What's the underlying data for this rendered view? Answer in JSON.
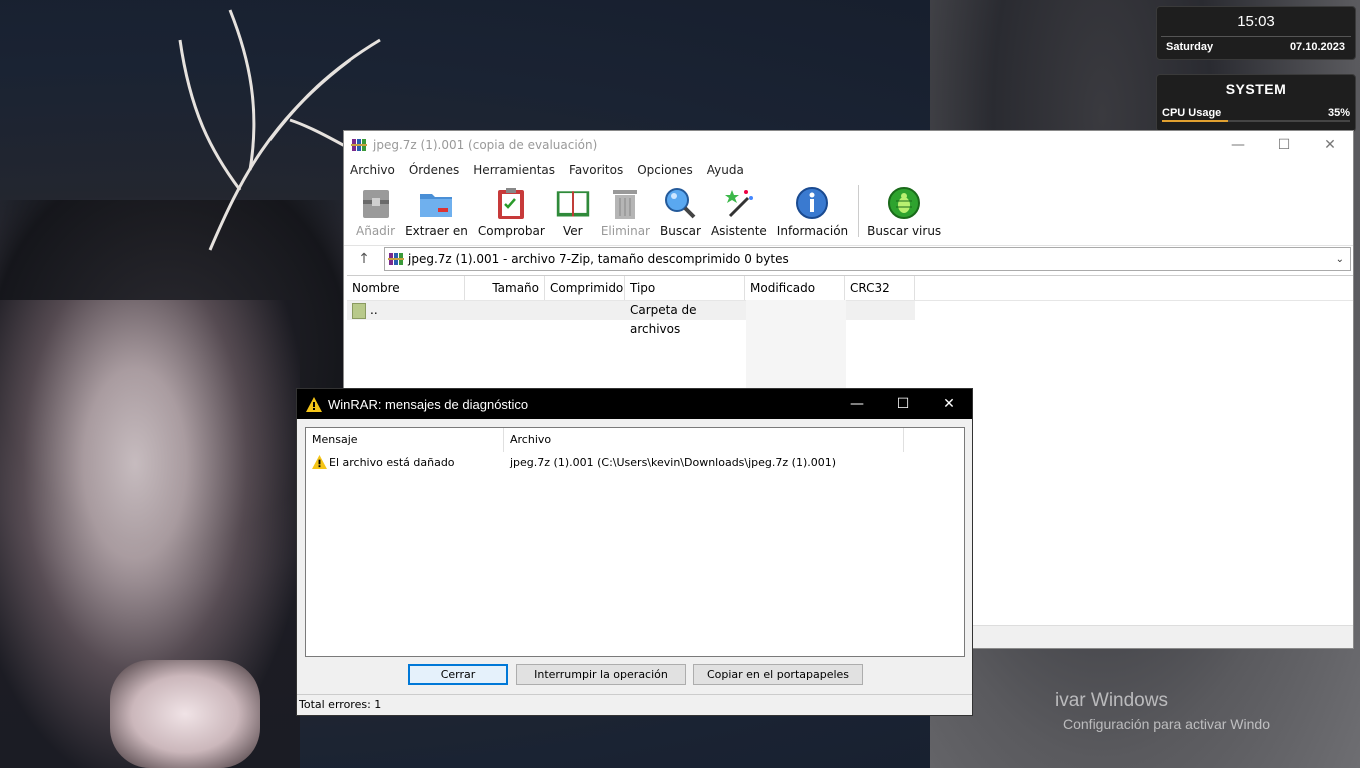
{
  "widgets": {
    "clock": {
      "time": "15:03",
      "day": "Saturday",
      "date": "07.10.2023"
    },
    "system": {
      "title": "SYSTEM",
      "cpu_label": "CPU Usage",
      "cpu_value": "35%",
      "cpu_fraction": 0.35
    }
  },
  "main_window": {
    "title": "jpeg.7z (1).001 (copia de evaluación)",
    "menu": [
      "Archivo",
      "Órdenes",
      "Herramientas",
      "Favoritos",
      "Opciones",
      "Ayuda"
    ],
    "toolbar": [
      {
        "label": "Añadir",
        "icon": "archive-add-icon",
        "enabled": false
      },
      {
        "label": "Extraer en",
        "icon": "folder-extract-icon",
        "enabled": true
      },
      {
        "label": "Comprobar",
        "icon": "clipboard-check-icon",
        "enabled": true
      },
      {
        "label": "Ver",
        "icon": "book-view-icon",
        "enabled": true
      },
      {
        "label": "Eliminar",
        "icon": "trash-icon",
        "enabled": false
      },
      {
        "label": "Buscar",
        "icon": "magnifier-icon",
        "enabled": true
      },
      {
        "label": "Asistente",
        "icon": "wizard-wand-icon",
        "enabled": true
      },
      {
        "label": "Información",
        "icon": "info-icon",
        "enabled": true
      },
      {
        "label": "Buscar virus",
        "icon": "bug-scan-icon",
        "enabled": true
      }
    ],
    "path": "jpeg.7z (1).001 - archivo 7-Zip, tamaño descomprimido 0 bytes",
    "columns": [
      "Nombre",
      "Tamaño",
      "Comprimido",
      "Tipo",
      "Modificado",
      "CRC32"
    ],
    "rows": [
      {
        "name": "..",
        "size": "",
        "packed": "",
        "type": "Carpeta de archivos",
        "modified": "",
        "crc": ""
      }
    ]
  },
  "dialog": {
    "title": "WinRAR: mensajes de diagnóstico",
    "columns": [
      "Mensaje",
      "Archivo"
    ],
    "rows": [
      {
        "message": "El archivo está dañado",
        "file": "jpeg.7z (1).001 (C:\\Users\\kevin\\Downloads\\jpeg.7z (1).001)"
      }
    ],
    "buttons": {
      "close": "Cerrar",
      "interrupt": "Interrumpir la operación",
      "copy": "Copiar en el portapapeles"
    },
    "status": "Total errores: 1"
  },
  "activate": {
    "line1": "ivar Windows",
    "line2": "Configuración para activar Windo"
  }
}
